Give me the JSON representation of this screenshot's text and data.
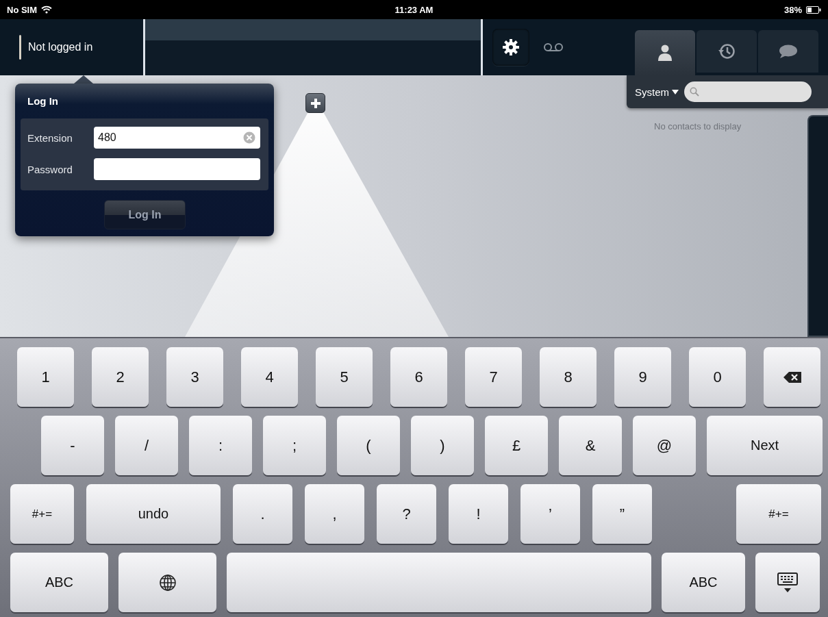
{
  "status_bar": {
    "carrier": "No SIM",
    "time": "11:23 AM",
    "battery": "38%"
  },
  "top_bar": {
    "login_status": "Not logged in"
  },
  "tabs": [
    {
      "kind": "person",
      "selected": true
    },
    {
      "kind": "history",
      "selected": false
    },
    {
      "kind": "chat",
      "selected": false
    }
  ],
  "contacts": {
    "source": "System",
    "empty_message": "No contacts to display"
  },
  "login": {
    "title": "Log In",
    "fields": [
      {
        "label": "Extension",
        "value": "480"
      },
      {
        "label": "Password"
      }
    ],
    "button": {
      "label": "Log In",
      "disabled": true
    }
  },
  "keyboard": {
    "rows": [
      [
        {
          "kind": "char",
          "label": "1"
        },
        {
          "kind": "char",
          "label": "2"
        },
        {
          "kind": "char",
          "label": "3"
        },
        {
          "kind": "char",
          "label": "4"
        },
        {
          "kind": "char",
          "label": "5"
        },
        {
          "kind": "char",
          "label": "6"
        },
        {
          "kind": "char",
          "label": "7"
        },
        {
          "kind": "char",
          "label": "8"
        },
        {
          "kind": "char",
          "label": "9"
        },
        {
          "kind": "char",
          "label": "0"
        },
        {
          "kind": "backspace"
        }
      ],
      [
        {
          "kind": "char",
          "label": "-"
        },
        {
          "kind": "char",
          "label": "/"
        },
        {
          "kind": "char",
          "label": ":"
        },
        {
          "kind": "char",
          "label": ";"
        },
        {
          "kind": "char",
          "label": "("
        },
        {
          "kind": "char",
          "label": ")"
        },
        {
          "kind": "char",
          "label": "£"
        },
        {
          "kind": "char",
          "label": "&"
        },
        {
          "kind": "char",
          "label": "@"
        },
        {
          "kind": "char",
          "label": "Next"
        }
      ],
      [
        {
          "kind": "char",
          "label": "#+="
        },
        {
          "kind": "char",
          "label": "undo"
        },
        {
          "kind": "char",
          "label": "."
        },
        {
          "kind": "char",
          "label": ","
        },
        {
          "kind": "char",
          "label": "?"
        },
        {
          "kind": "char",
          "label": "!"
        },
        {
          "kind": "char",
          "label": "’"
        },
        {
          "kind": "char",
          "label": "”"
        },
        {
          "kind": "char",
          "label": "#+="
        }
      ],
      [
        {
          "kind": "char",
          "label": "ABC"
        },
        {
          "kind": "globe"
        },
        {
          "kind": "space"
        },
        {
          "kind": "char",
          "label": "ABC"
        },
        {
          "kind": "hide"
        }
      ]
    ]
  }
}
